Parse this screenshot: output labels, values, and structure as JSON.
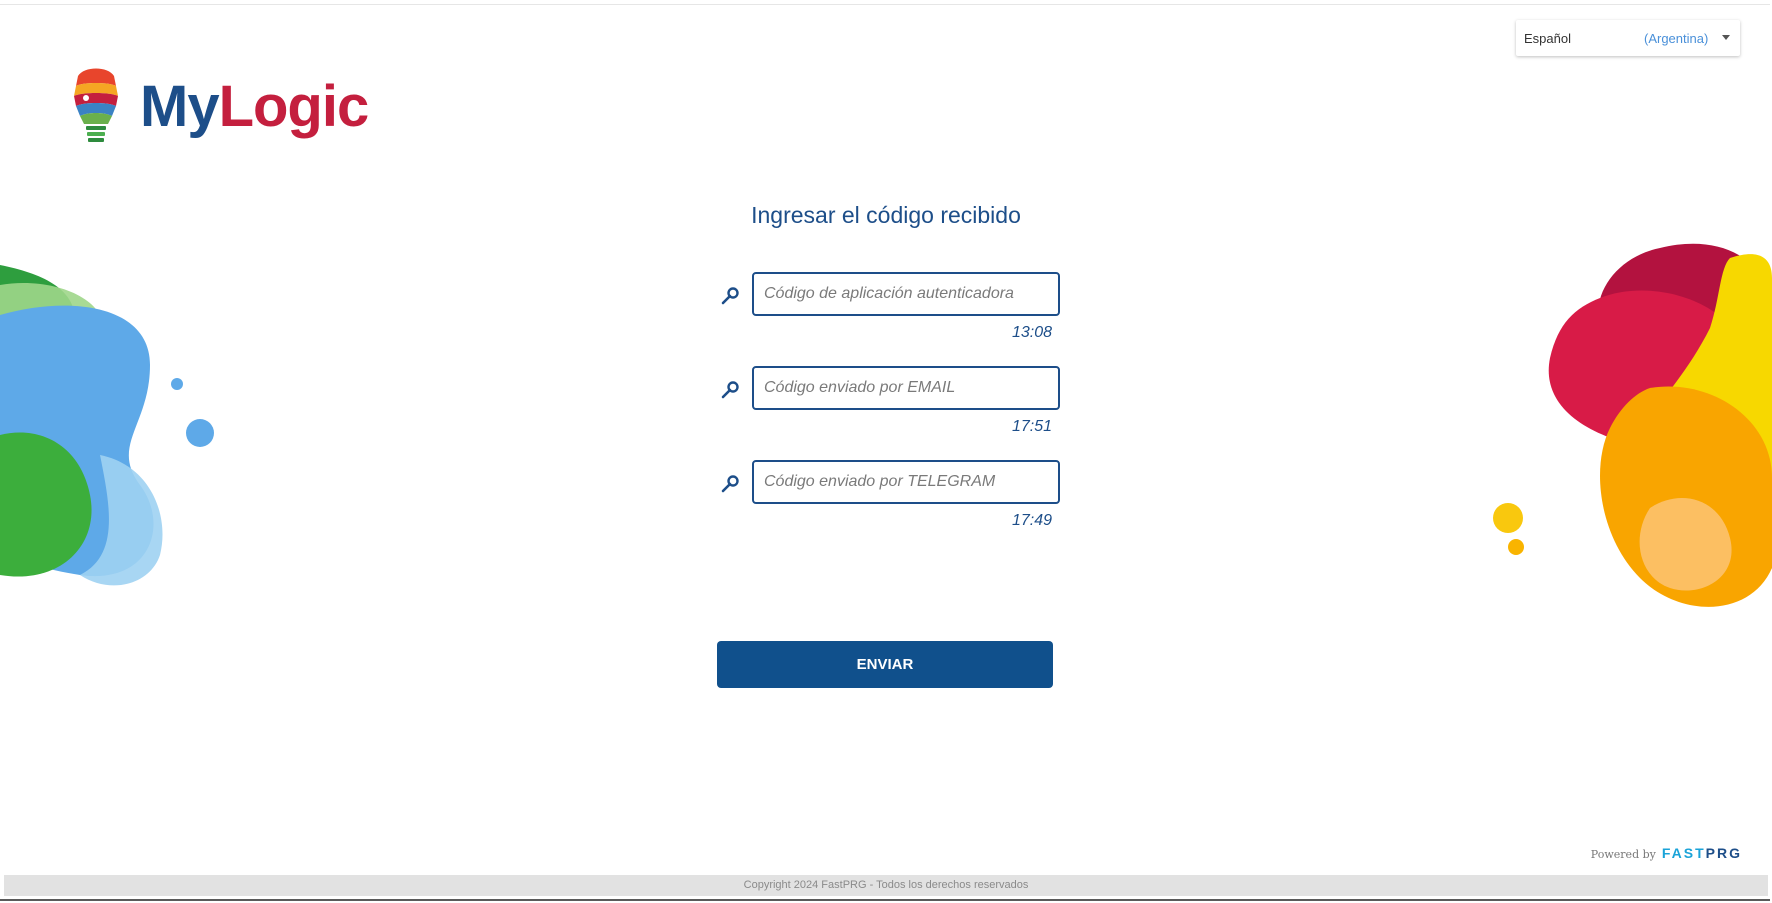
{
  "language": {
    "name": "Español",
    "region": "(Argentina)"
  },
  "logo": {
    "part1": "My",
    "part2": "Logic"
  },
  "form": {
    "title": "Ingresar el código recibido",
    "fields": [
      {
        "placeholder": "Código de aplicación autenticadora",
        "timer": "13:08",
        "icon": "key-icon"
      },
      {
        "placeholder": "Código enviado por EMAIL",
        "timer": "17:51",
        "icon": "key-icon"
      },
      {
        "placeholder": "Código enviado por TELEGRAM",
        "timer": "17:49",
        "icon": "key-icon"
      }
    ],
    "submit_label": "ENVIAR"
  },
  "powered_by": {
    "label": "Powered by",
    "brand_a": "FAST",
    "brand_b": "PRG"
  },
  "footer": {
    "copyright": "Copyright 2024 FastPRG - Todos los derechos reservados"
  },
  "colors": {
    "primary": "#1d4e89",
    "button": "#10508c",
    "brand_red": "#c41f3e"
  }
}
